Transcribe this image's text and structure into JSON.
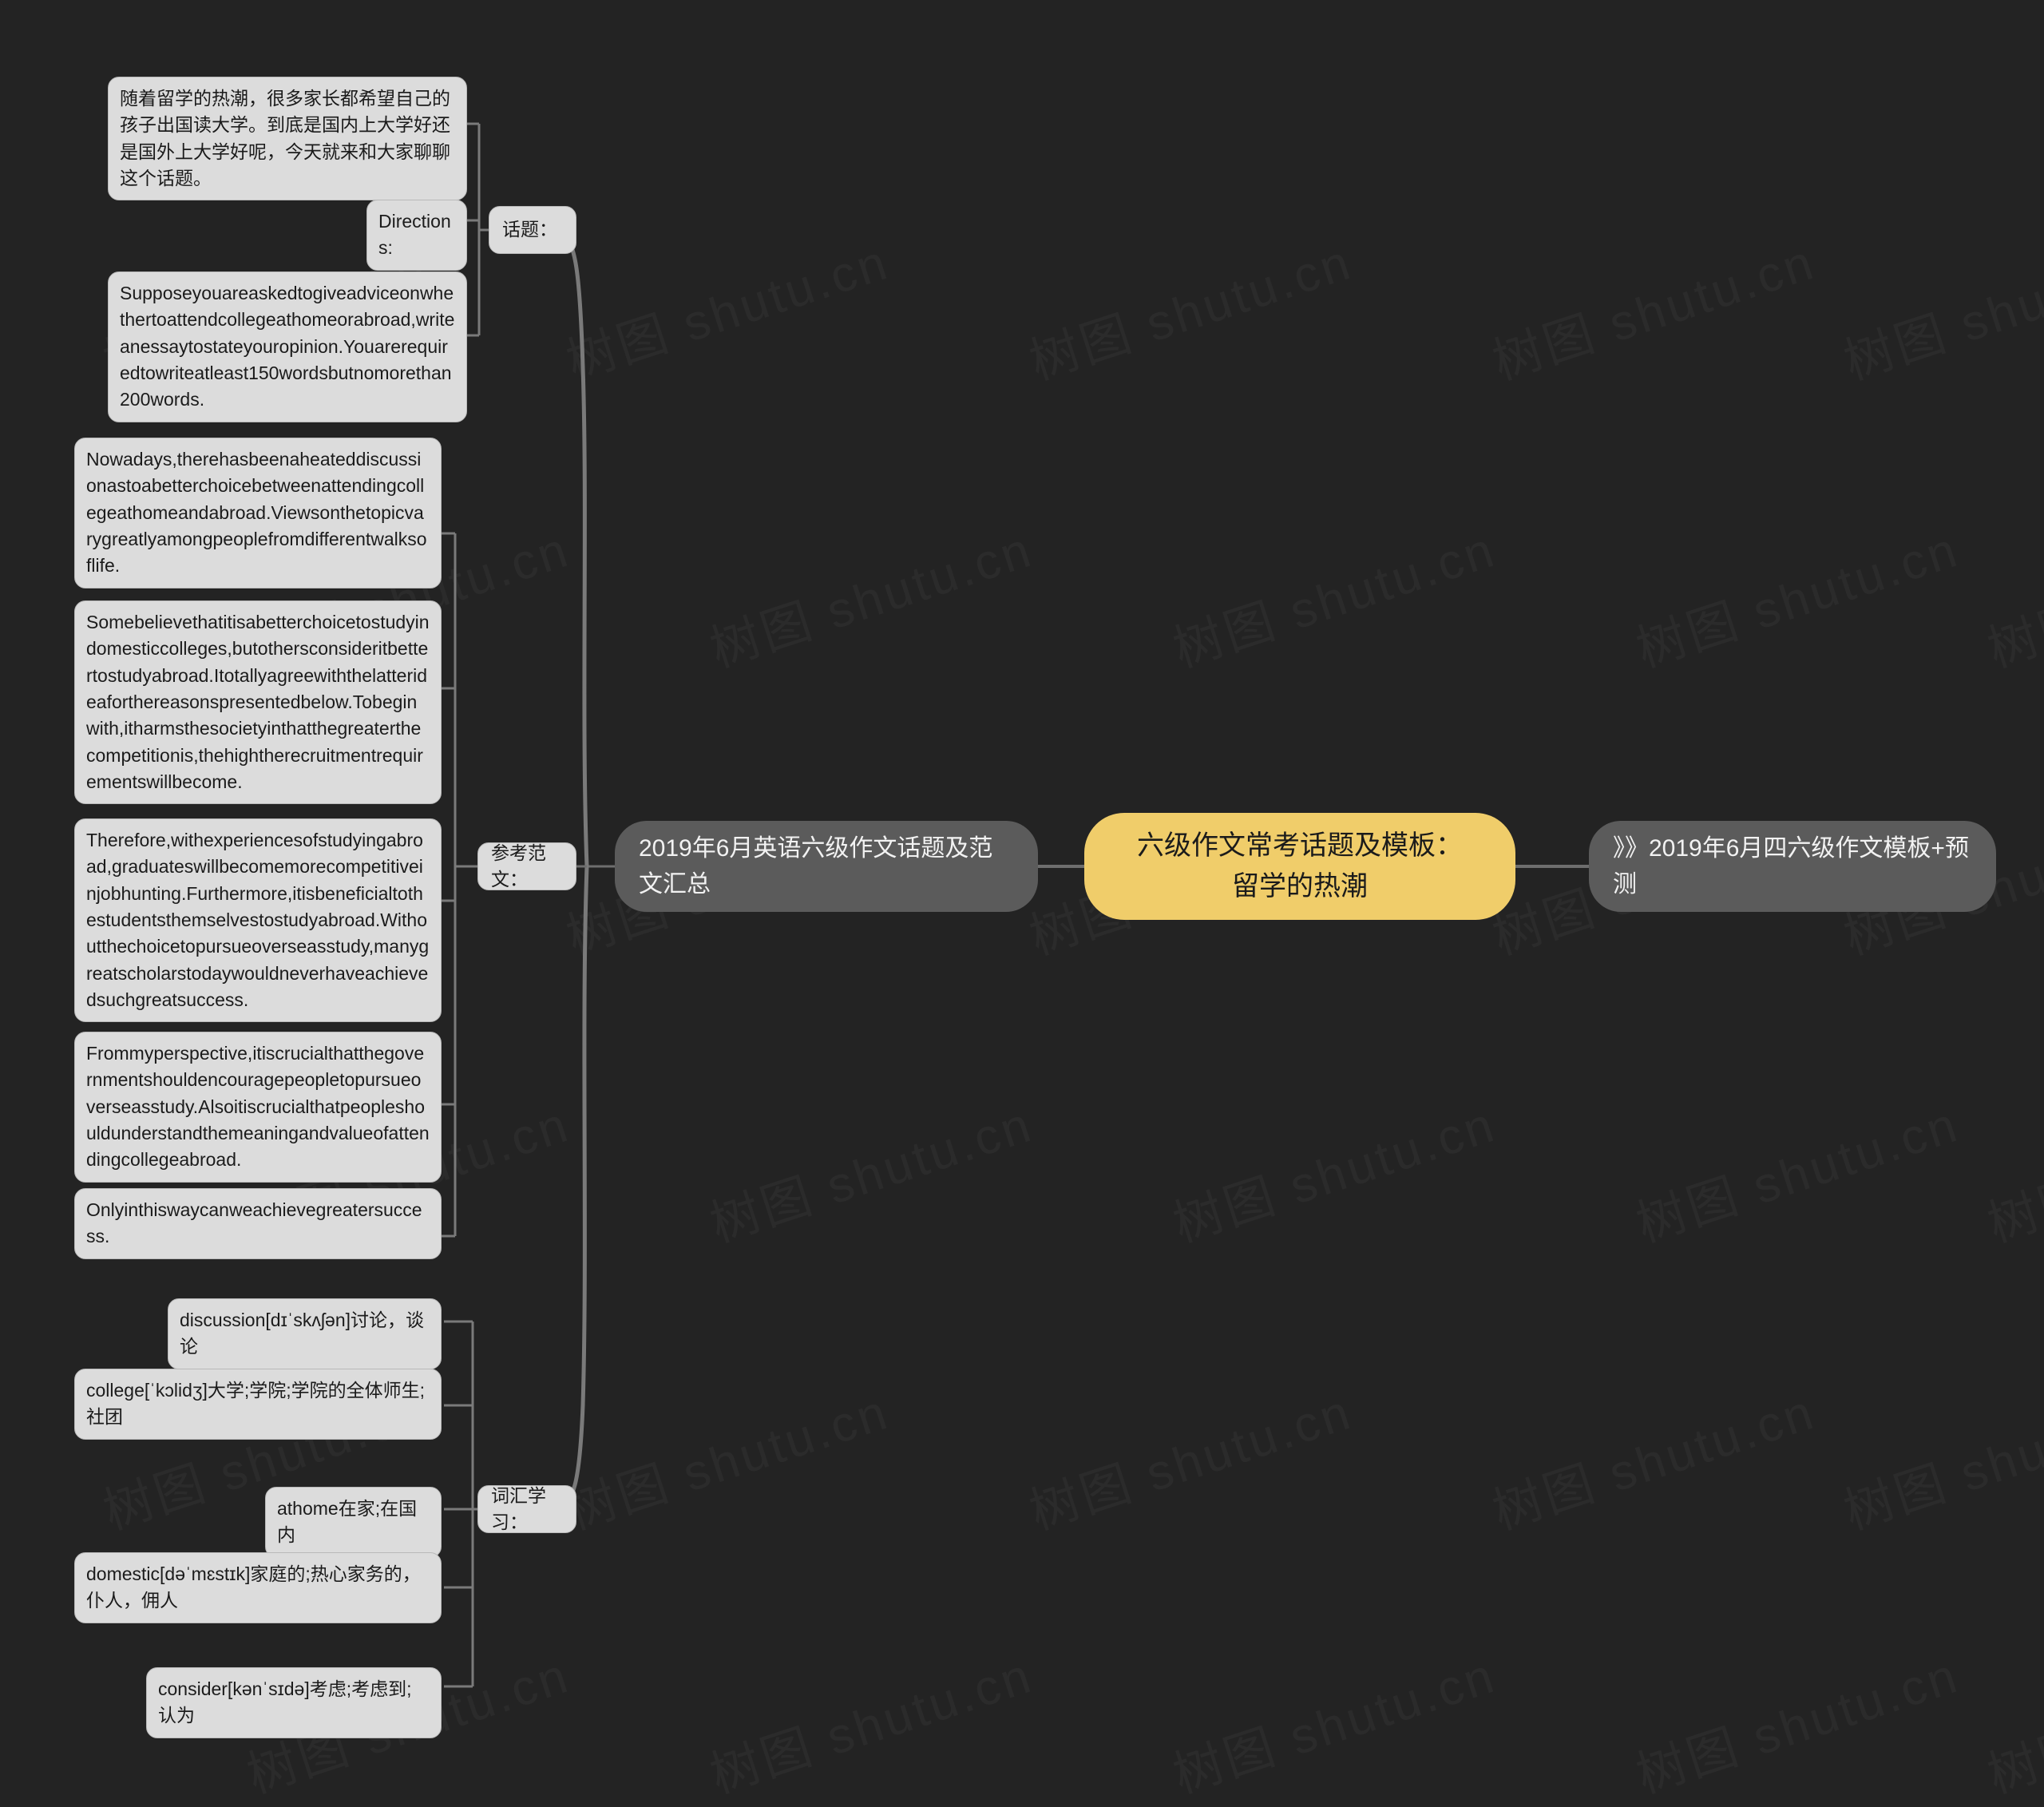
{
  "canvas": {
    "background": "#232323",
    "node_fill": "#dcdcdc",
    "topic_fill": "#5b5b5b",
    "root_fill": "#f0cd6a",
    "link_color": "#6e6e6e"
  },
  "watermark": {
    "text": "树图 shutu.cn"
  },
  "root": {
    "label": "六级作文常考话题及模板：留学的热潮"
  },
  "topics": {
    "left": "2019年6月英语六级作文话题及范文汇总",
    "right": "》》2019年6月四六级作文模板+预测"
  },
  "branches": [
    {
      "label": "话题：",
      "children": [
        "随着留学的热潮，很多家长都希望自己的孩子出国读大学。到底是国内上大学好还是国外上大学好呢，今天就来和大家聊聊这个话题。",
        "Directions:",
        "Supposeyouareaskedtogiveadviceonwhethertoattendcollegeathomeorabroad,writeanessaytostateyouropinion.Youarerequiredtowriteatleast150wordsbutnomorethan200words."
      ]
    },
    {
      "label": "参考范文：",
      "children": [
        "Nowadays,therehasbeenaheateddiscussionastoabetterchoicebetweenattendingcollegeathomeandabroad.Viewsonthetopicvarygreatlyamongpeoplefromdifferentwalksoflife.",
        "Somebelievethatitisabetterchoicetostudyindomesticcolleges,butothersconsideritbettertostudyabroad.Itotallyagreewiththelatterideaforthereasonspresentedbelow.Tobeginwith,itharmsthesocietyinthatthegreaterthecompetitionis,thehightherecruitmentrequirementswillbecome.",
        "Therefore,withexperiencesofstudyingabroad,graduateswillbecomemorecompetitiveinjobhunting.Furthermore,itisbeneficialtothestudentsthemselvestostudyabroad.Withoutthechoicetopursueoverseasstudy,manygreatscholarstodaywouldneverhaveachievedsuchgreatsuccess.",
        "Frommyperspective,itiscrucialthatthegovernmentshouldencouragepeopletopursueoverseasstudy.Alsoitiscrucialthatpeopleshouldunderstandthemeaningandvalueofattendingcollegeabroad.",
        "Onlyinthiswaycanweachievegreatersuccess."
      ]
    },
    {
      "label": "词汇学习：",
      "children": [
        "discussion[dɪˈskʌʃən]讨论，谈论",
        "college[ˈkɔlidʒ]大学;学院;学院的全体师生;社团",
        "athome在家;在国内",
        "domestic[dəˈmɛstɪk]家庭的;热心家务的，仆人，佣人",
        "consider[kənˈsɪdə]考虑;考虑到;认为"
      ]
    }
  ]
}
